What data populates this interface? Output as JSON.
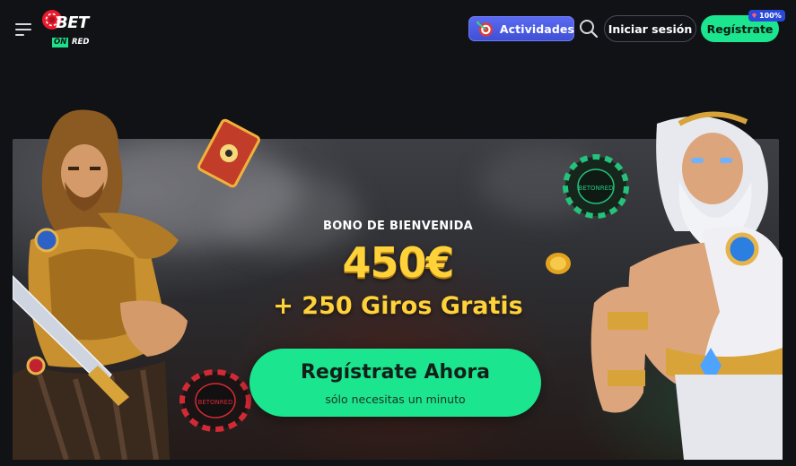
{
  "header": {
    "menu_icon": "hamburger-menu-icon",
    "logo": {
      "bet": "BET",
      "on": "ON",
      "red": "RED"
    },
    "activities_label": "Actividades",
    "activities_icon": "target-dart-icon",
    "search_icon": "search-icon",
    "login_label": "Iniciar sesión",
    "register_label": "Regístrate",
    "register_badge": "100%",
    "badge_icon": "gem-icon"
  },
  "banner": {
    "subtitle": "BONO DE BIENVENIDA",
    "amount": "450€",
    "spins": "+ 250 Giros Gratis",
    "cta_title": "Regístrate Ahora",
    "cta_subtitle": "sólo necesitas un minuto",
    "chip_text": "BETONRED"
  },
  "colors": {
    "accent_green": "#1be58e",
    "activities_blue": "#4f5fe8",
    "bonus_gold": "#ffd23a",
    "background": "#111216"
  }
}
